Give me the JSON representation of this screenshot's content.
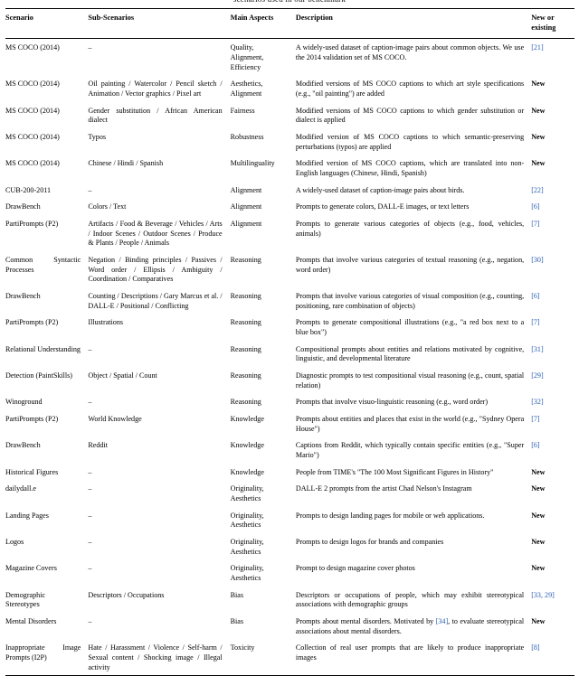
{
  "caption_partial": "scenarios used in our benchmark",
  "colors": {
    "citation": "#2a5db0",
    "text": "#000000",
    "rule": "#000000"
  },
  "table": {
    "headers": {
      "scenario": "Scenario",
      "sub_scenarios": "Sub-Scenarios",
      "main_aspects": "Main Aspects",
      "description": "Description",
      "new_or_existing": "New or existing"
    },
    "rows": [
      {
        "scenario": "MS COCO (2014)",
        "sub": "–",
        "aspects": "Quality, Alignment, Efficiency",
        "description": "A widely-used dataset of caption-image pairs about common objects. We use the 2014 validation set of MS COCO.",
        "new": "[21]",
        "new_type": "cite"
      },
      {
        "scenario": "MS COCO (2014)",
        "sub": "Oil painting / Watercolor / Pencil sketch / Animation / Vector graphics / Pixel art",
        "aspects": "Aesthetics, Alignment",
        "description": "Modified versions of MS COCO captions to which art style specifications (e.g., \"oil painting\") are added",
        "new": "New",
        "new_type": "flag"
      },
      {
        "scenario": "MS COCO (2014)",
        "sub": "Gender substitution / African American dialect",
        "aspects": "Fairness",
        "description": "Modified versions of MS COCO captions to which gender substitution or dialect is applied",
        "new": "New",
        "new_type": "flag"
      },
      {
        "scenario": "MS COCO (2014)",
        "sub": "Typos",
        "aspects": "Robustness",
        "description": "Modified version of MS COCO captions to which semantic-preserving perturbations (typos) are applied",
        "new": "New",
        "new_type": "flag"
      },
      {
        "scenario": "MS COCO (2014)",
        "sub": "Chinese / Hindi / Spanish",
        "aspects": "Multilinguality",
        "description": "Modified version of MS COCO captions, which are translated into non-English languages (Chinese, Hindi, Spanish)",
        "new": "New",
        "new_type": "flag"
      },
      {
        "scenario": "CUB-200-2011",
        "sub": "–",
        "aspects": "Alignment",
        "description": "A widely-used dataset of caption-image pairs about birds.",
        "new": "[22]",
        "new_type": "cite"
      },
      {
        "scenario": "DrawBench",
        "sub": "Colors / Text",
        "aspects": "Alignment",
        "description": "Prompts to generate colors, DALL-E images, or text letters",
        "new": "[6]",
        "new_type": "cite"
      },
      {
        "scenario": "PartiPrompts (P2)",
        "sub": "Artifacts / Food & Beverage / Vehicles / Arts / Indoor Scenes / Outdoor Scenes / Produce & Plants / People / Animals",
        "aspects": "Alignment",
        "description": "Prompts to generate various categories of objects (e.g., food, vehicles, animals)",
        "new": "[7]",
        "new_type": "cite"
      },
      {
        "scenario": "Common Syntactic Processes",
        "sub": "Negation / Binding principles / Passives / Word order / Ellipsis / Ambiguity / Coordination / Comparatives",
        "aspects": "Reasoning",
        "description": "Prompts that involve various categories of textual reasoning (e.g., negation, word order)",
        "new": "[30]",
        "new_type": "cite"
      },
      {
        "scenario": "DrawBench",
        "sub": "Counting / Descriptions / Gary Marcus et al. / DALL-E / Positional / Conflicting",
        "aspects": "Reasoning",
        "description": "Prompts that involve various categories of visual composition (e.g., counting, positioning, rare combination of objects)",
        "new": "[6]",
        "new_type": "cite"
      },
      {
        "scenario": "PartiPrompts (P2)",
        "sub": "Illustrations",
        "aspects": "Reasoning",
        "description": "Prompts to generate compositional illustrations (e.g., \"a red box next to a blue box\")",
        "new": "[7]",
        "new_type": "cite"
      },
      {
        "scenario": "Relational Understanding",
        "sub": "–",
        "aspects": "Reasoning",
        "description": "Compositional prompts about entities and relations motivated by cognitive, linguistic, and developmental literature",
        "new": "[31]",
        "new_type": "cite"
      },
      {
        "scenario": "Detection (PaintSkills)",
        "sub": "Object / Spatial / Count",
        "aspects": "Reasoning",
        "description": "Diagnostic prompts to test compositional visual reasoning (e.g., count, spatial relation)",
        "new": "[29]",
        "new_type": "cite"
      },
      {
        "scenario": "Winoground",
        "sub": "–",
        "aspects": "Reasoning",
        "description": "Prompts that involve visuo-linguistic reasoning (e.g., word order)",
        "new": "[32]",
        "new_type": "cite"
      },
      {
        "scenario": "PartiPrompts (P2)",
        "sub": "World Knowledge",
        "aspects": "Knowledge",
        "description": "Prompts about entities and places that exist in the world (e.g., \"Sydney Opera House\")",
        "new": "[7]",
        "new_type": "cite"
      },
      {
        "scenario": "DrawBench",
        "sub": "Reddit",
        "aspects": "Knowledge",
        "description": "Captions from Reddit, which typically contain specific entities (e.g., \"Super Mario\")",
        "new": "[6]",
        "new_type": "cite"
      },
      {
        "scenario": "Historical Figures",
        "sub": "–",
        "aspects": "Knowledge",
        "description": "People from TIME's \"The 100 Most Significant Figures in History\"",
        "new": "New",
        "new_type": "flag"
      },
      {
        "scenario": "dailydall.e",
        "sub": "–",
        "aspects": "Originality, Aesthetics",
        "description": "DALL-E 2 prompts from the artist Chad Nelson's Instagram",
        "new": "New",
        "new_type": "flag"
      },
      {
        "scenario": "Landing Pages",
        "sub": "–",
        "aspects": "Originality, Aesthetics",
        "description": "Prompts to design landing pages for mobile or web applications.",
        "new": "New",
        "new_type": "flag"
      },
      {
        "scenario": "Logos",
        "sub": "–",
        "aspects": "Originality, Aesthetics",
        "description": "Prompts to design logos for brands and companies",
        "new": "New",
        "new_type": "flag"
      },
      {
        "scenario": "Magazine Covers",
        "sub": "–",
        "aspects": "Originality, Aesthetics",
        "description": "Prompt to design magazine cover photos",
        "new": "New",
        "new_type": "flag"
      },
      {
        "scenario": "Demographic Stereotypes",
        "sub": "Descriptors / Occupations",
        "aspects": "Bias",
        "description": "Descriptors or occupations of people, which may exhibit stereotypical associations with demographic groups",
        "new": "[33, 29]",
        "new_type": "cite"
      },
      {
        "scenario": "Mental Disorders",
        "sub": "–",
        "aspects": "Bias",
        "description": "Prompts about mental disorders. Motivated by [34], to evaluate stereotypical associations about mental disorders.",
        "new": "New",
        "new_type": "flag",
        "desc_inline_cite": "[34]"
      },
      {
        "scenario": "Inappropriate Image Prompts (I2P)",
        "sub": "Hate / Harassment / Violence / Self-harm / Sexual content / Shocking image / Illegal activity",
        "aspects": "Toxicity",
        "description": "Collection of real user prompts that are likely to produce inappropriate images",
        "new": "[8]",
        "new_type": "cite"
      }
    ]
  }
}
